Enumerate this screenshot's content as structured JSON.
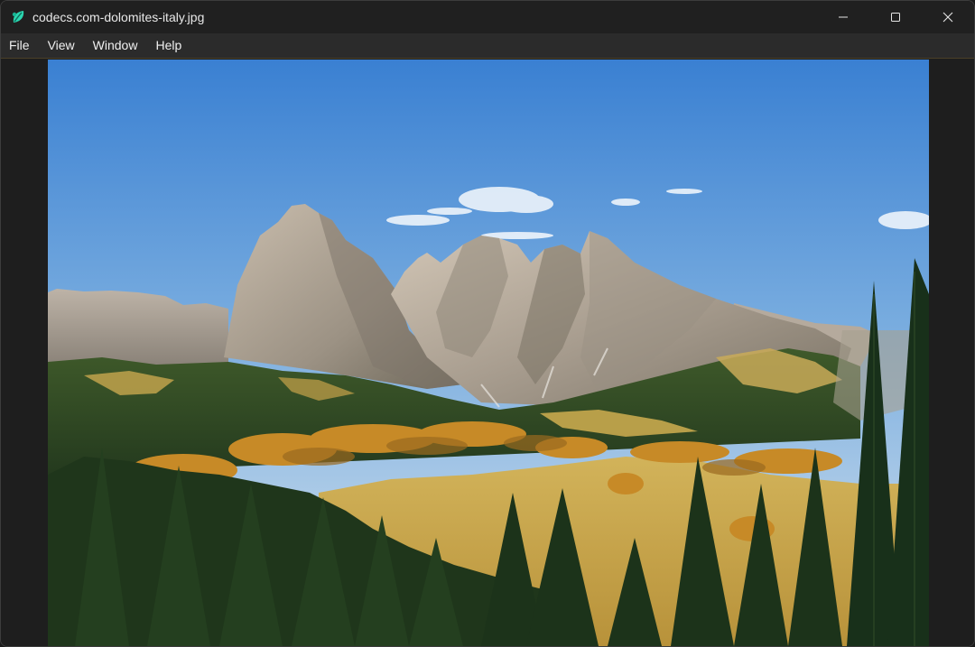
{
  "window": {
    "title": "codecs.com-dolomites-italy.jpg",
    "app_icon": "leaf-icon",
    "controls": [
      "minimize-icon",
      "maximize-icon",
      "close-icon"
    ]
  },
  "menu": {
    "items": [
      {
        "label": "File"
      },
      {
        "label": "View"
      },
      {
        "label": "Window"
      },
      {
        "label": "Help"
      }
    ]
  },
  "image": {
    "subject": "dolomites-landscape",
    "colors": {
      "sky_top": "#3e86d6",
      "sky_bottom": "#cfe0ef",
      "rock": "#a59a8c",
      "meadow": "#c9a347",
      "forest": "#1f3a1c"
    }
  }
}
